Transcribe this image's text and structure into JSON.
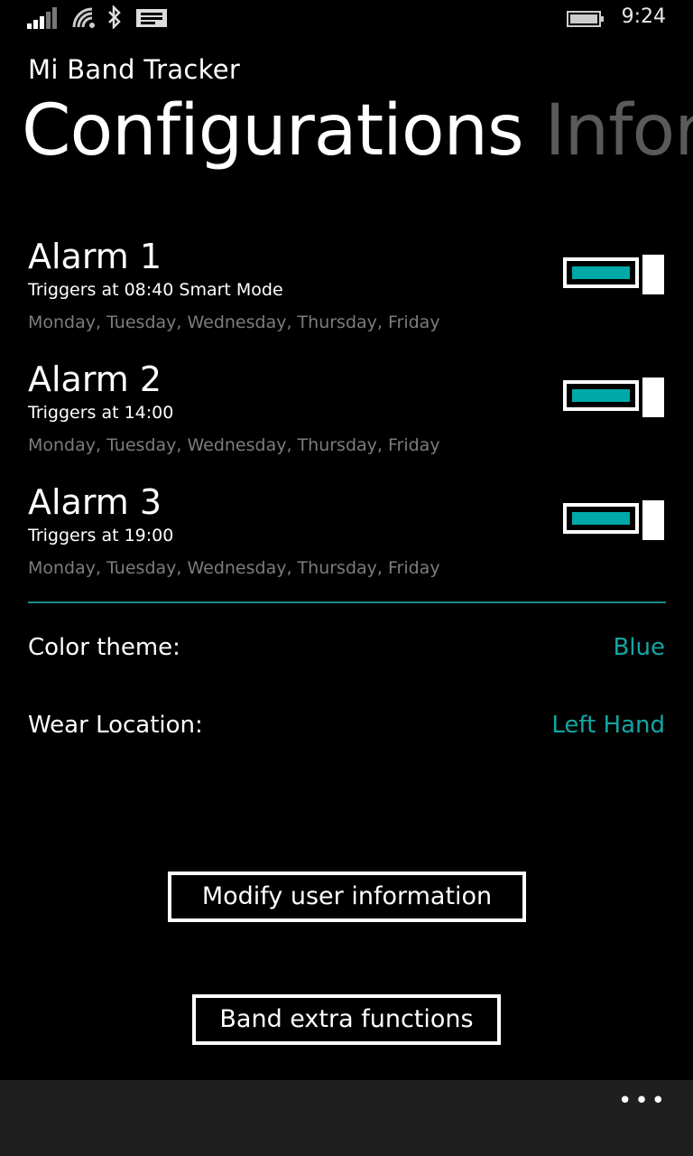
{
  "status_bar": {
    "time": "9:24",
    "icons": [
      "signal-icon",
      "wifi-icon",
      "bluetooth-icon",
      "message-icon",
      "battery-icon"
    ]
  },
  "app_title": "Mi Band Tracker",
  "pivot": {
    "active": "Configurations",
    "next": "Infor"
  },
  "alarms": [
    {
      "name": "Alarm 1",
      "trigger": "Triggers at 08:40 Smart Mode",
      "days": "Monday, Tuesday, Wednesday, Thursday, Friday",
      "enabled": true
    },
    {
      "name": "Alarm 2",
      "trigger": "Triggers at 14:00",
      "days": "Monday, Tuesday, Wednesday, Thursday, Friday",
      "enabled": true
    },
    {
      "name": "Alarm 3",
      "trigger": "Triggers at 19:00",
      "days": "Monday, Tuesday, Wednesday, Thursday, Friday",
      "enabled": true
    }
  ],
  "settings": {
    "color_theme": {
      "label": "Color theme:",
      "value": "Blue"
    },
    "wear_location": {
      "label": "Wear Location:",
      "value": "Left Hand"
    }
  },
  "buttons": {
    "modify_user": "Modify user information",
    "band_extra": "Band extra functions"
  },
  "app_bar": {
    "more": "•••"
  },
  "colors": {
    "accent": "#00a9a8",
    "background": "#000000",
    "app_bar": "#1f1f1f"
  }
}
